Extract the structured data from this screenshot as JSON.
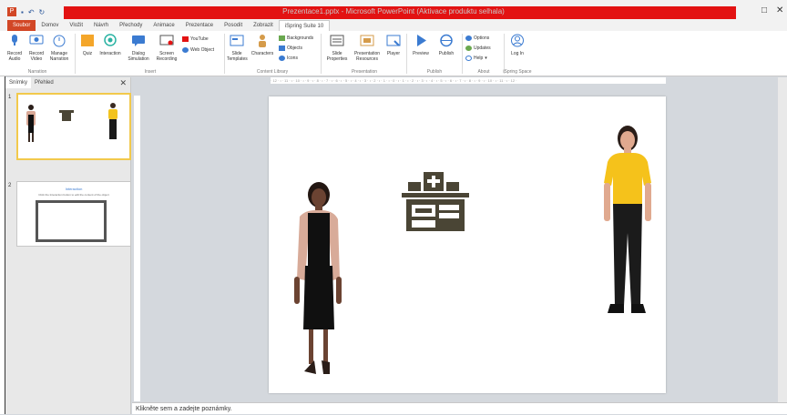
{
  "window": {
    "title": "Prezentace1.pptx - Microsoft PowerPoint (Aktivace produktu selhala)",
    "controls": {
      "minimize": "–",
      "restore": "□",
      "close": "✕"
    },
    "accent_color": "#e31212"
  },
  "quick_access": {
    "app_icon": "P",
    "undo": "↶",
    "redo": "↻"
  },
  "tabs": [
    {
      "label": "Soubor",
      "type": "file"
    },
    {
      "label": "Domov"
    },
    {
      "label": "Vložit"
    },
    {
      "label": "Návrh"
    },
    {
      "label": "Přechody"
    },
    {
      "label": "Animace"
    },
    {
      "label": "Prezentace"
    },
    {
      "label": "Posodit"
    },
    {
      "label": "Zobrazit"
    },
    {
      "label": "iSpring Suite 10",
      "active": true
    }
  ],
  "ribbon": {
    "narration": {
      "record_audio": "Record Audio",
      "record_video": "Record Video",
      "manage_narration": "Manage Narration",
      "group": "Narration"
    },
    "insert": {
      "quiz": "Quiz",
      "interaction": "Interaction",
      "dialog_simulation": "Dialog Simulation",
      "screen_recording": "Screen Recording",
      "youtube": "YouTube",
      "web_object": "Web Object",
      "group": "Insert"
    },
    "content_library": {
      "slide_templates": "Slide Templates",
      "characters": "Characters",
      "backgrounds": "Backgrounds",
      "objects": "Objects",
      "icons": "Icons",
      "group": "Content Library"
    },
    "presentation": {
      "slide_properties": "Slide Properties",
      "presentation_resources": "Presentation Resources",
      "player": "Player",
      "group": "Presentation"
    },
    "publish": {
      "preview": "Preview",
      "publish": "Publish",
      "group": "Publish"
    },
    "about": {
      "options": "Options",
      "updates": "Updates",
      "help": "Help",
      "group": "About"
    },
    "ispring_space": {
      "log_in": "Log In",
      "group": "iSpring Space"
    }
  },
  "slide_panel": {
    "tabs": [
      "Snímky",
      "Přehled"
    ],
    "close": "✕",
    "slides": [
      {
        "number": "1"
      },
      {
        "number": "2",
        "title": "Interaction",
        "subtitle": "Click the Interaction button to edit the content of the object"
      }
    ]
  },
  "ruler": {
    "ticks": "· 12 · ı · 11 · ı · 10 · ı · 9 · ı · 8 · ı · 7 · ı · 6 · ı · 5 · ı · 4 · ı · 3 · ı · 2 · ı · 1 · ı · 0 · ı · 1 · ı · 2 · ı · 3 · ı · 4 · ı · 5 · ı · 6 · ı · 7 · ı · 8 · ı · 9 · ı · 10 · ı · 11 · ı · 12 ·"
  },
  "notes": {
    "placeholder": "Klikněte sem a zadejte poznámky."
  }
}
